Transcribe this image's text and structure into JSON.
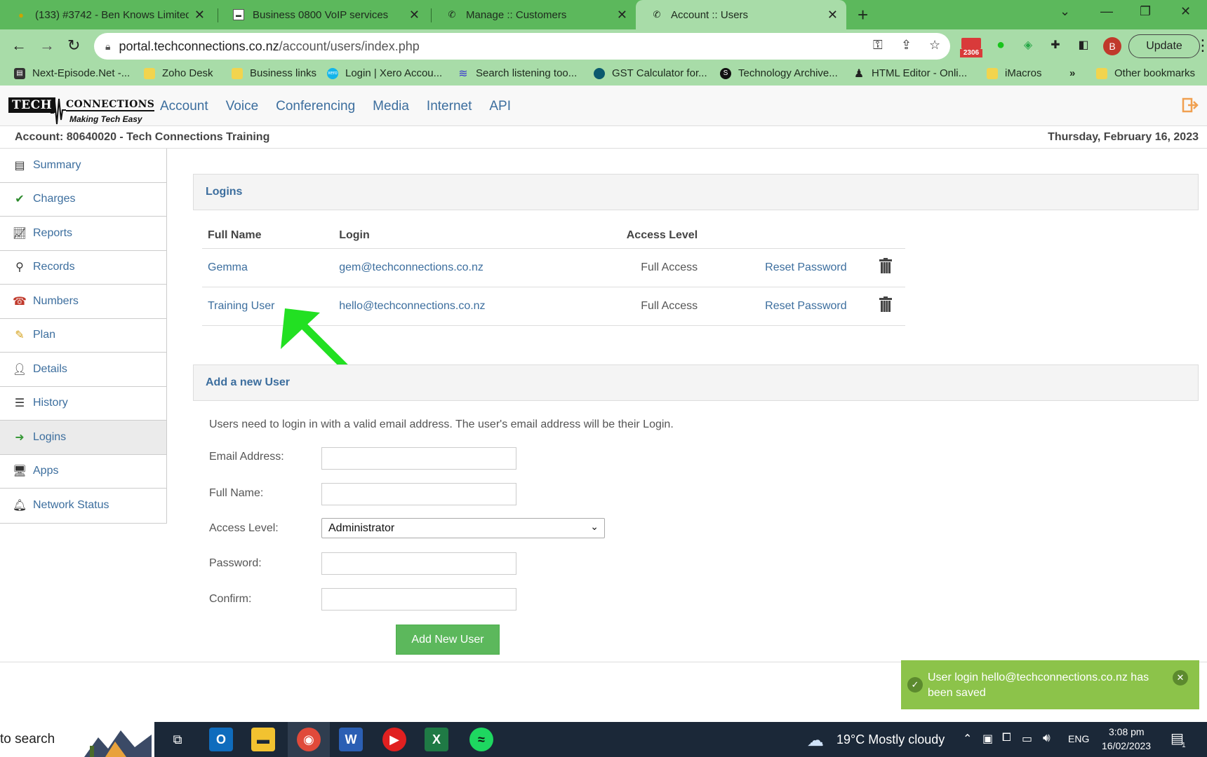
{
  "browser": {
    "tabs": [
      {
        "title": "(133) #3742 - Ben Knows Limited",
        "active": false
      },
      {
        "title": "Business 0800 VoIP services",
        "active": false
      },
      {
        "title": "Manage :: Customers",
        "active": false
      },
      {
        "title": "Account :: Users",
        "active": true
      }
    ],
    "url_host": "portal.techconnections.co.nz",
    "url_path": "/account/users/index.php",
    "mail_count": "2306",
    "profile_initial": "B",
    "update_label": "Update",
    "bookmarks": [
      "Next-Episode.Net -...",
      "Zoho Desk",
      "Business links",
      "Login | Xero Accou...",
      "Search listening too...",
      "GST Calculator for...",
      "Technology Archive...",
      "HTML Editor - Onli...",
      "iMacros"
    ],
    "bookmarks_more": "»",
    "other_bookmarks": "Other bookmarks"
  },
  "site": {
    "logo_tech": "TECH",
    "logo_connections": "CONNECTIONS",
    "logo_tagline": "Making Tech Easy",
    "nav": [
      "Account",
      "Voice",
      "Conferencing",
      "Media",
      "Internet",
      "API"
    ],
    "account_line": "Account:  80640020  -  Tech Connections Training",
    "date": "Thursday, February 16, 2023"
  },
  "sidebar": {
    "items": [
      {
        "label": "Summary",
        "icon": "summary-icon"
      },
      {
        "label": "Charges",
        "icon": "checkmark-icon"
      },
      {
        "label": "Reports",
        "icon": "chart-icon"
      },
      {
        "label": "Records",
        "icon": "magnifier-icon"
      },
      {
        "label": "Numbers",
        "icon": "telephone-icon"
      },
      {
        "label": "Plan",
        "icon": "pencil-icon"
      },
      {
        "label": "Details",
        "icon": "person-icon"
      },
      {
        "label": "History",
        "icon": "list-icon"
      },
      {
        "label": "Logins",
        "icon": "login-icon"
      },
      {
        "label": "Apps",
        "icon": "monitor-icon"
      },
      {
        "label": "Network Status",
        "icon": "bell-icon"
      }
    ],
    "active": "Logins"
  },
  "logins": {
    "title": "Logins",
    "columns": [
      "Full Name",
      "Login",
      "Access Level"
    ],
    "rows": [
      {
        "name": "Gemma",
        "login": "gem@techconnections.co.nz",
        "access": "Full Access",
        "action": "Reset Password"
      },
      {
        "name": "Training User",
        "login": "hello@techconnections.co.nz",
        "access": "Full Access",
        "action": "Reset Password"
      }
    ]
  },
  "add_user": {
    "title": "Add a new User",
    "intro": "Users need to login in with a valid email address. The user's email address will be their Login.",
    "email_label": "Email Address:",
    "fullname_label": "Full Name:",
    "access_label": "Access Level:",
    "access_value": "Administrator",
    "password_label": "Password:",
    "confirm_label": "Confirm:",
    "submit_label": "Add New User"
  },
  "toast": {
    "message": "User login hello@techconnections.co.nz has been saved"
  },
  "taskbar": {
    "search_text": "to search",
    "weather": "19°C  Mostly cloudy",
    "language": "ENG",
    "time": "3:08 pm",
    "date": "16/02/2023",
    "notification_count": "1"
  },
  "colors": {
    "accent_green": "#5cb85c",
    "link_blue": "#3c6e9e",
    "arrow_green": "#22e022",
    "toast_green": "#8cc34a"
  }
}
